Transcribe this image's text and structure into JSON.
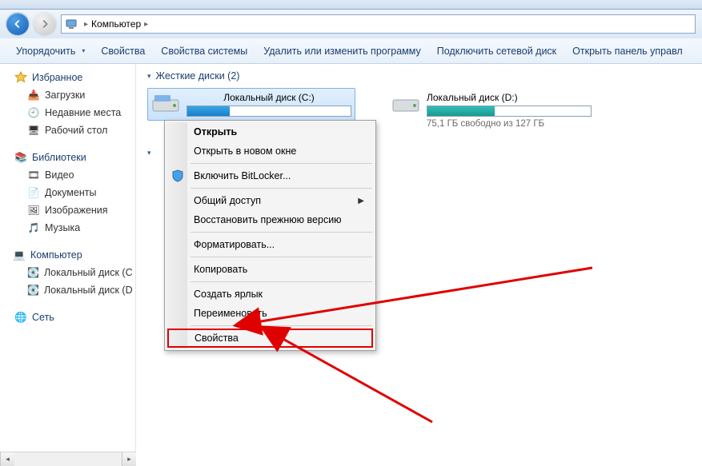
{
  "breadcrumb": {
    "root": "Компьютер"
  },
  "toolbar": {
    "organize": "Упорядочить",
    "properties": "Свойства",
    "sys_props": "Свойства системы",
    "uninstall": "Удалить или изменить программу",
    "map_drive": "Подключить сетевой диск",
    "ctrl_panel": "Открыть панель управл"
  },
  "sidebar": {
    "favorites": {
      "label": "Избранное",
      "items": [
        "Загрузки",
        "Недавние места",
        "Рабочий стол"
      ]
    },
    "libraries": {
      "label": "Библиотеки",
      "items": [
        "Видео",
        "Документы",
        "Изображения",
        "Музыка"
      ]
    },
    "computer": {
      "label": "Компьютер",
      "items": [
        "Локальный диск (C",
        "Локальный диск (D"
      ]
    },
    "network": {
      "label": "Сеть"
    }
  },
  "content": {
    "hdd_header": "Жесткие диски (2)",
    "drives": [
      {
        "name": "Локальный диск (C:)",
        "fill_pct": 26,
        "color": "blue",
        "free": ""
      },
      {
        "name": "Локальный диск (D:)",
        "fill_pct": 41,
        "color": "teal",
        "free": "75,1 ГБ свободно из 127 ГБ"
      }
    ]
  },
  "ctxmenu": {
    "open": "Открыть",
    "open_new": "Открыть в новом окне",
    "bitlocker": "Включить BitLocker...",
    "share": "Общий доступ",
    "restore": "Восстановить прежнюю версию",
    "format": "Форматировать...",
    "copy": "Копировать",
    "shortcut": "Создать ярлык",
    "rename": "Переименовать",
    "props": "Свойства"
  }
}
